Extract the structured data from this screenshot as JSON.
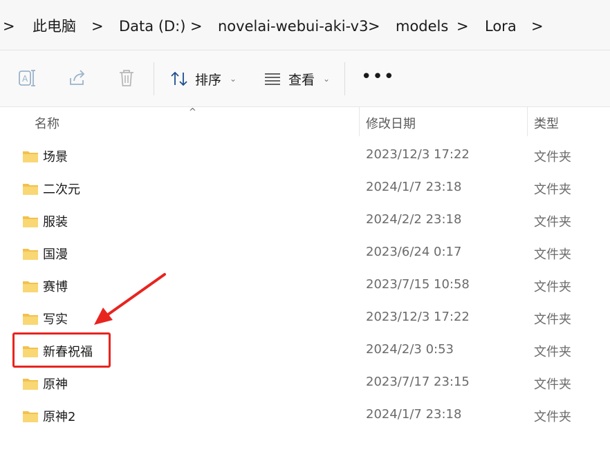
{
  "breadcrumb": {
    "items": [
      "此电脑",
      "Data (D:)",
      "novelai-webui-aki-v3",
      "models",
      "Lora"
    ],
    "separator": ">"
  },
  "toolbar": {
    "sort_label": "排序",
    "view_label": "查看",
    "more_label": "•••",
    "icons": [
      "rename-icon",
      "share-icon",
      "delete-icon",
      "sort-icon",
      "view-icon"
    ]
  },
  "columns": {
    "name": "名称",
    "date": "修改日期",
    "type": "类型"
  },
  "files": [
    {
      "name": "场景",
      "date": "2023/12/3 17:22",
      "type": "文件夹"
    },
    {
      "name": "二次元",
      "date": "2024/1/7 23:18",
      "type": "文件夹"
    },
    {
      "name": "服装",
      "date": "2024/2/2 23:18",
      "type": "文件夹"
    },
    {
      "name": "国漫",
      "date": "2023/6/24 0:17",
      "type": "文件夹"
    },
    {
      "name": "赛博",
      "date": "2023/7/15 10:58",
      "type": "文件夹"
    },
    {
      "name": "写实",
      "date": "2023/12/3 17:22",
      "type": "文件夹"
    },
    {
      "name": "新春祝福",
      "date": "2024/2/3 0:53",
      "type": "文件夹"
    },
    {
      "name": "原神",
      "date": "2023/7/17 23:15",
      "type": "文件夹"
    },
    {
      "name": "原神2",
      "date": "2024/1/7 23:18",
      "type": "文件夹"
    }
  ],
  "annotation": {
    "highlighted_item": "新春祝福",
    "color": "#e8241f"
  },
  "colors": {
    "folder": "#f2c14e",
    "accent": "#e8241f"
  }
}
